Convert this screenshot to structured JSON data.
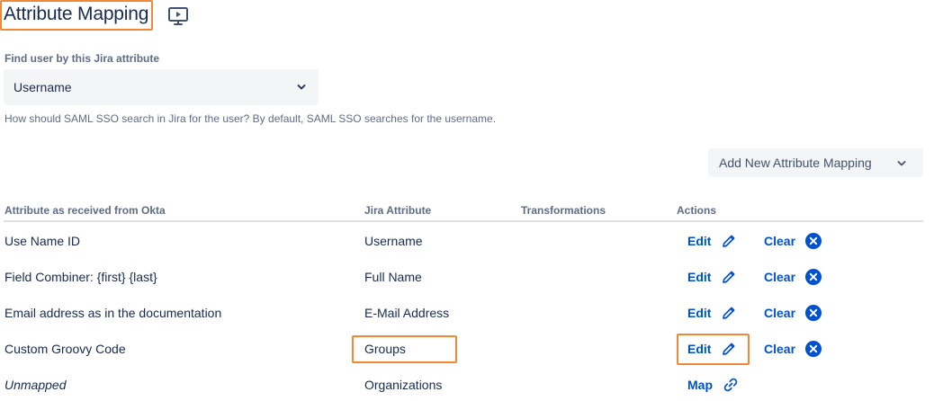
{
  "header": {
    "title": "Attribute Mapping",
    "video_icon": "presentation-play-icon"
  },
  "lookup": {
    "label": "Find user by this Jira attribute",
    "selected": "Username",
    "help": "How should SAML SSO search in Jira for the user? By default, SAML SSO searches for the username."
  },
  "toolbar": {
    "add_label": "Add New Attribute Mapping"
  },
  "table": {
    "columns": [
      "Attribute as received from Okta",
      "Jira Attribute",
      "Transformations",
      "Actions"
    ],
    "rows": [
      {
        "source": "Use Name ID",
        "jira": "Username",
        "transform": "",
        "primary": "Edit",
        "secondary": "Clear"
      },
      {
        "source": "Field Combiner: {first} {last}",
        "jira": "Full Name",
        "transform": "",
        "primary": "Edit",
        "secondary": "Clear"
      },
      {
        "source": "Email address as in the documentation",
        "jira": "E-Mail Address",
        "transform": "",
        "primary": "Edit",
        "secondary": "Clear"
      },
      {
        "source": "Custom Groovy Code",
        "jira": "Groups",
        "transform": "",
        "primary": "Edit",
        "secondary": "Clear"
      },
      {
        "source": "Unmapped",
        "jira": "Organizations",
        "transform": "",
        "primary": "Map",
        "secondary": ""
      }
    ]
  },
  "colors": {
    "link": "#0052cc",
    "highlight": "#f0883a",
    "text": "#172b4d",
    "muted": "#5e6c84"
  }
}
